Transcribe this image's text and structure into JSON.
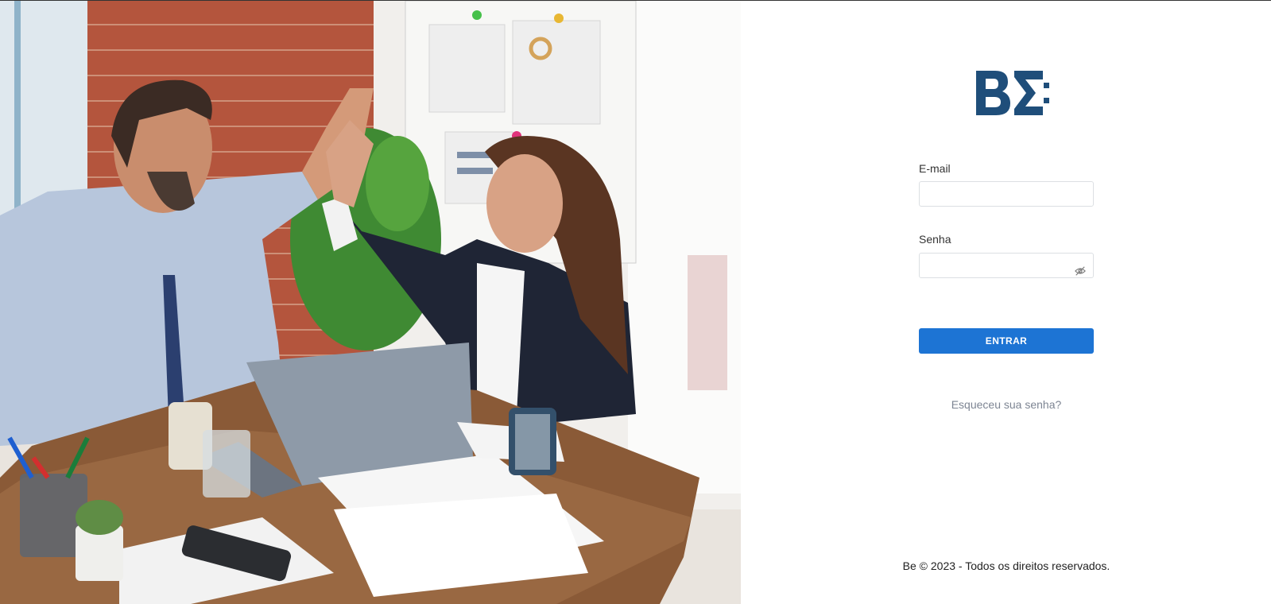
{
  "brand": {
    "logo_text": "BΣ",
    "logo_color": "#1f4e7a"
  },
  "login": {
    "email_label": "E-mail",
    "email_value": "",
    "password_label": "Senha",
    "password_value": "",
    "password_toggle_icon": "eye-slash-icon",
    "submit_label": "ENTRAR",
    "submit_color": "#1d74d4",
    "forgot_label": "Esqueceu sua senha?"
  },
  "footer": {
    "text": "Be © 2023 - Todos os direitos reservados."
  },
  "hero_image": {
    "subject": "two colleagues giving a high five at an office desk"
  }
}
